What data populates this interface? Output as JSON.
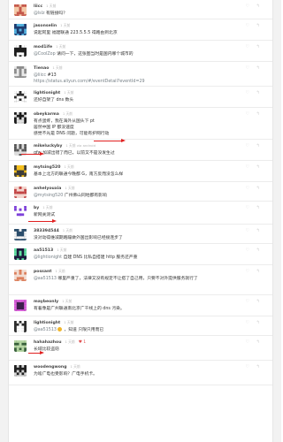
{
  "replies": [
    {
      "user": "liicc",
      "time": "1 天前",
      "lines": [
        [
          {
            "at": "@lslz"
          },
          {
            "t": " 有链接吗？"
          }
        ]
      ],
      "avatar": {
        "bg": "#f4c9a8",
        "fg": "#c4574a"
      }
    },
    {
      "user": "jasonselin",
      "time": "1 天前",
      "lines": [
        [
          {
            "t": "说起阿里 福建联通 223.5.5.5 得路由到北京"
          }
        ]
      ],
      "avatar": {
        "bg": "#1f3c70",
        "fg": "#56b4e0"
      }
    },
    {
      "user": "mod1ife",
      "time": "1 天前",
      "lines": [
        [
          {
            "at": "@CoolZop"
          },
          {
            "t": " 请问一下，这张图当时是国内哪个城市的"
          }
        ]
      ],
      "avatar": {
        "bg": "#1e1e1e",
        "fg": "#ffffff"
      }
    },
    {
      "user": "Tienao",
      "time": "1 天前",
      "lines": [
        [
          {
            "at": "@liicc"
          },
          {
            "t": " #13"
          }
        ],
        [
          {
            "t": "https://status.aliyun.com/#/eventDetail?eventId=29"
          }
        ]
      ],
      "avatar": {
        "bg": "#eaeaea",
        "fg": "#8c8c8c"
      }
    },
    {
      "user": "lightionight",
      "time": "1 天前",
      "lines": [
        [
          {
            "t": "还好自架了 dns 数头"
          }
        ]
      ],
      "avatar": {
        "bg": "#2d2d2d",
        "fg": "#ffffff"
      }
    },
    {
      "user": "obeykarma",
      "time": "1 天前",
      "lines": [
        [
          {
            "t": "有点蛋疼，我在海外从国头下 pt"
          }
        ],
        [
          {
            "t": "居然中国 IP 都没速度"
          }
        ],
        [
          {
            "t": "感觉不光是 DNS 问题，可能有护网行动"
          }
        ]
      ],
      "avatar": {
        "bg": "#1a1a1a",
        "fg": "#e1e1e1"
      }
    },
    {
      "user": "mikeluckyby",
      "time": "1 天前 via android",
      "lines": [
        [
          {
            "t": "gfw 加减出错了而已，以前又不是没发生过"
          }
        ]
      ],
      "avatar": {
        "bg": "#dddddd",
        "fg": "#555555"
      }
    },
    {
      "user": "mytsing520",
      "time": "1 天前",
      "lines": [
        [
          {
            "t": "基本上北方的联通今晚都 G，南方反而没怎么样"
          }
        ]
      ],
      "avatar": {
        "bg": "#f5c01e",
        "fg": "#3a3a3a"
      }
    },
    {
      "user": "anhelyouxia",
      "time": "1 天前",
      "lines": [
        [
          {
            "at": "@mytsing520"
          },
          {
            "t": " 广州佛山同地都有影响"
          }
        ]
      ],
      "avatar": {
        "bg": "#f3d6cf",
        "fg": "#c24545"
      }
    },
    {
      "user": "by",
      "time": "1 天前",
      "lines": [
        [
          {
            "t": "新网关测试"
          }
        ]
      ],
      "avatar": {
        "bg": "#ffffff",
        "fg": "#7d3fd9"
      }
    },
    {
      "user": "383394544",
      "time": "1 天前",
      "lines": [
        [
          {
            "t": "没对动得维减期路蹦做外国出影响已经接连步了"
          }
        ]
      ],
      "avatar": {
        "bg": "#2c4e6c",
        "fg": "#f3f3f3"
      }
    },
    {
      "user": "aa51513",
      "time": "1 天前",
      "lines": [
        [
          {
            "at": "@lightionight"
          },
          {
            "t": " 自建 DNS 比私自搭建 http 服务还严重"
          }
        ]
      ],
      "avatar": {
        "bg": "#1b1b3c",
        "fg": "#62e0a2"
      }
    },
    {
      "user": "possant",
      "time": "1 天前",
      "lines": [
        [
          {
            "at": "@aa51513"
          },
          {
            "t": " 哪里严重了，法律又没有规定不让搭了自己用，只要不对外提供服务就行了"
          }
        ]
      ],
      "avatar": {
        "bg": "#f2ddd2",
        "fg": "#dc7f5c"
      }
    },
    {
      "user": "maybeonly",
      "time": "1 天前",
      "lines": [
        [
          {
            "t": "有着像是广州联通南北京广干线上的 dns 污染。"
          }
        ]
      ],
      "avatar": {
        "bg": "#3d1f4c",
        "fg": "#dc63dc"
      }
    },
    {
      "user": "lightionight",
      "time": "1 天前",
      "lines": [
        [
          {
            "at": "@aa51513"
          },
          {
            "icon": "emoji-icon"
          },
          {
            "t": " ，知道 只限只用而已"
          }
        ]
      ],
      "avatar": {
        "bg": "#2d2d2d",
        "fg": "#ffffff"
      }
    },
    {
      "user": "hahahazhou",
      "time": "1 天前",
      "heart": "1",
      "lines": [
        [
          {
            "t": "长域比较盗窃"
          }
        ]
      ],
      "avatar": {
        "bg": "#39613c",
        "fg": "#b8d7a6"
      }
    },
    {
      "user": "woodengwong",
      "time": "1 天前",
      "lines": [
        [
          {
            "t": "为啥广电也受影响？广电手机卡。"
          }
        ]
      ],
      "avatar": {
        "bg": "#202020",
        "fg": "#d7d7d7"
      }
    }
  ],
  "icons": {
    "heart": "heart-icon",
    "reply": "reply-arrow-icon"
  },
  "colors": {
    "flag": "#e02020",
    "at_link": "#778087",
    "background": "#ffffff"
  }
}
